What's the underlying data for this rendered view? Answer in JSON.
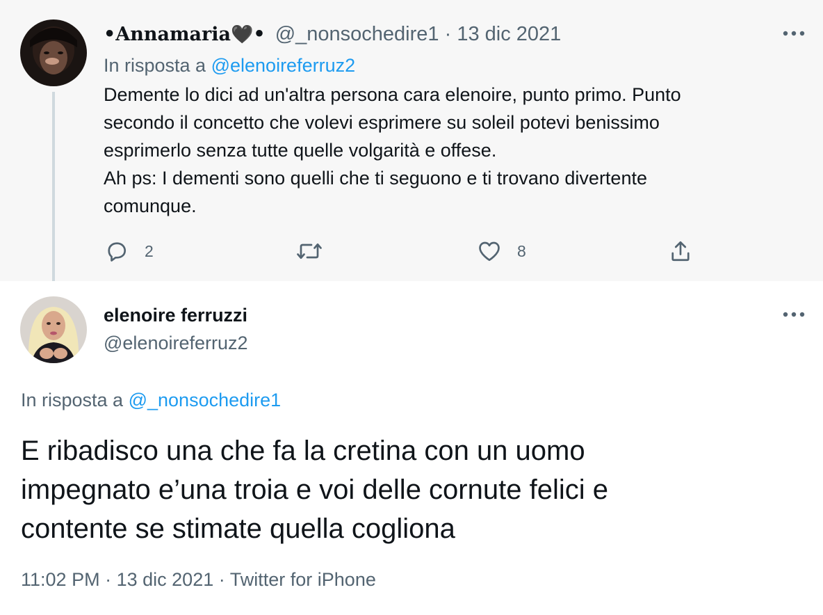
{
  "reply_tweet": {
    "display_name_prefix": "•",
    "display_name": "Annamaria",
    "display_name_emoji": "🖤",
    "display_name_suffix": "•",
    "handle": "@_nonsochedire1",
    "separator": "·",
    "date": "13 dic 2021",
    "in_reply_prefix": "In risposta a",
    "in_reply_handle": "@elenoireferruz2",
    "text_lines": [
      "Demente lo dici ad un'altra persona cara elenoire, punto primo. Punto",
      "secondo il concetto che volevi esprimere su soleil potevi benissimo",
      "esprimerlo senza tutte quelle volgarità e offese.",
      "Ah ps: I dementi sono quelli che ti seguono e ti trovano divertente",
      "comunque."
    ],
    "actions": {
      "reply_count": "2",
      "retweet_count": "",
      "like_count": "8"
    },
    "icons": [
      "reply-icon",
      "retweet-icon",
      "like-icon",
      "share-icon",
      "more-icon"
    ]
  },
  "main_tweet": {
    "display_name": "elenoire ferruzzi",
    "handle": "@elenoireferruz2",
    "in_reply_prefix": "In risposta a",
    "in_reply_handle": "@_nonsochedire1",
    "text_lines": [
      "E ribadisco una che fa la cretina con un uomo",
      "impegnato e’una troia e voi delle cornute felici e",
      "contente se stimate quella cogliona"
    ],
    "time": "11:02 PM",
    "separator": "·",
    "date": "13 dic 2021",
    "source": "Twitter for iPhone"
  },
  "colors": {
    "link_blue": "#1d9bf0",
    "secondary_text": "#536471",
    "reply_background": "#f7f7f7",
    "thread_line": "#cfd9de"
  }
}
